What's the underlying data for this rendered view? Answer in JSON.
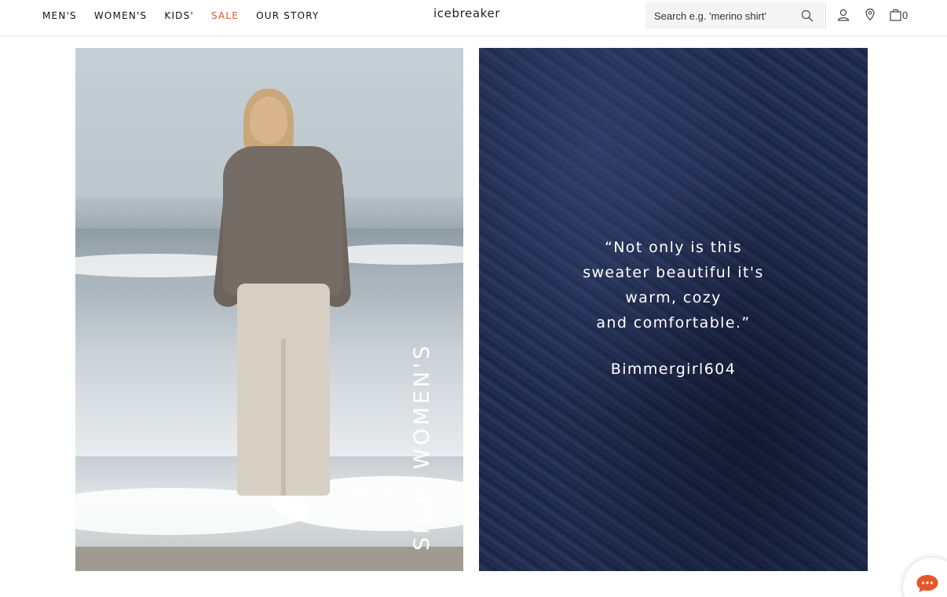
{
  "nav": {
    "items": [
      {
        "label": "MEN'S"
      },
      {
        "label": "WOMEN'S"
      },
      {
        "label": "KIDS'"
      },
      {
        "label": "SALE",
        "color": "#e8542a"
      },
      {
        "label": "OUR STORY"
      }
    ]
  },
  "logo": "icebreaker",
  "search": {
    "placeholder": "Search e.g. 'merino shirt'",
    "icon": "search-icon"
  },
  "utility": {
    "icons": [
      "account-icon",
      "store-locator-icon",
      "shopping-bag-icon"
    ],
    "bag_count": "0"
  },
  "hero": {
    "left": {
      "cta": "SHOP WOMEN'S"
    },
    "right": {
      "quote_lines": [
        "“Not only is this",
        "sweater beautiful it's",
        "warm, cozy",
        "and comfortable.”"
      ],
      "author": "Bimmergirl604"
    }
  },
  "chat": {
    "icon": "chat-bubble-icon",
    "color": "#e8542a"
  }
}
